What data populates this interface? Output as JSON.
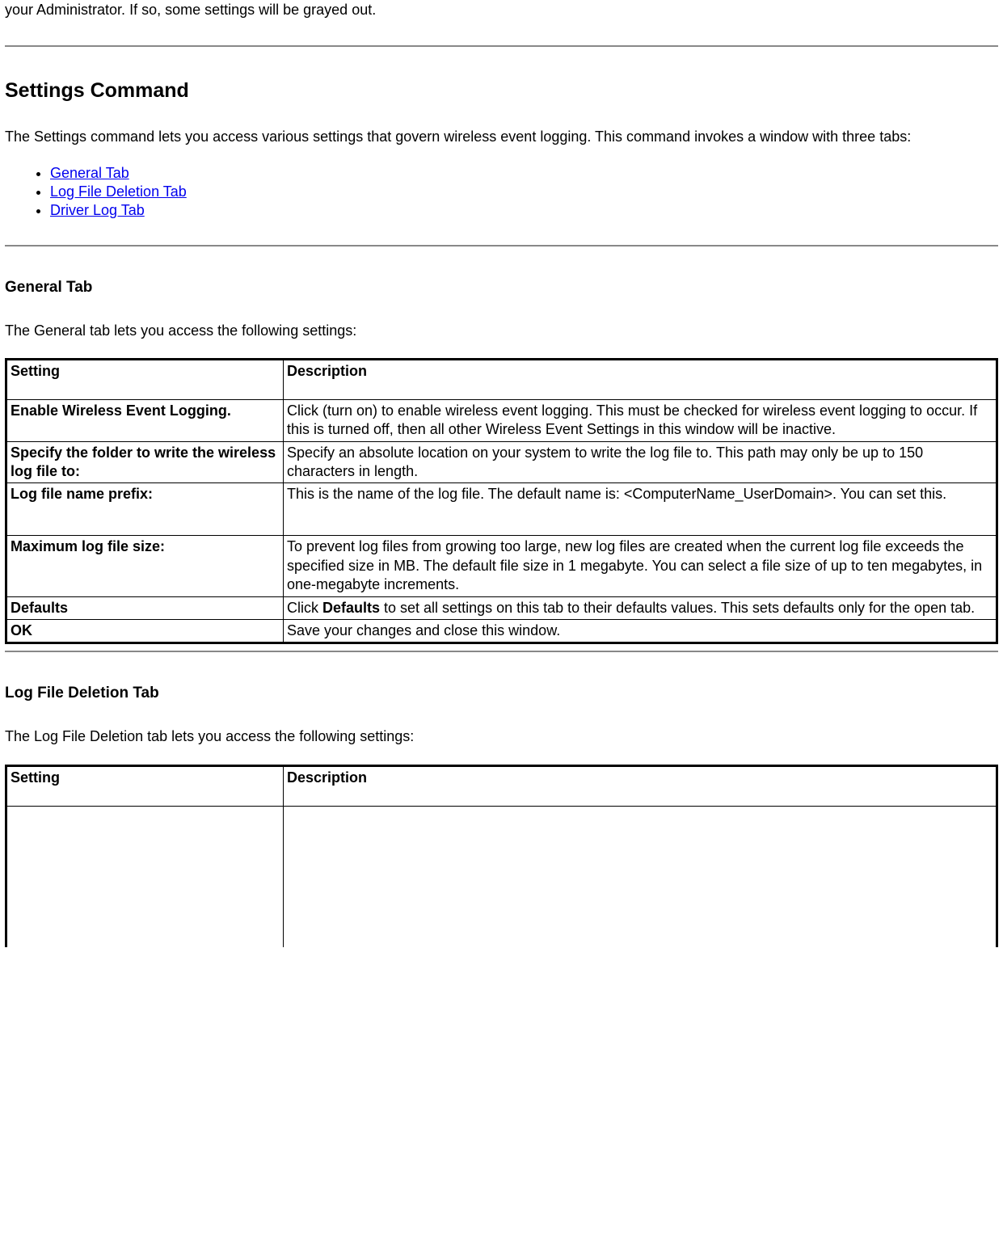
{
  "topFragment": "your Administrator. If so, some settings will be grayed out.",
  "settingsCommand": {
    "heading": "Settings Command",
    "intro": "The Settings command lets you access various settings that govern wireless event logging. This command invokes a window with three tabs:",
    "links": [
      "General Tab ",
      "Log File Deletion Tab",
      "Driver Log Tab"
    ]
  },
  "generalTab": {
    "heading": "General Tab",
    "intro": "The General tab lets you access the following settings:",
    "header": {
      "setting": "Setting",
      "description": "Description"
    },
    "rows": [
      {
        "setting": "Enable Wireless Event Logging.",
        "desc": "Click (turn on) to enable wireless event logging. This must be checked for wireless event logging to occur. If this is turned off, then all other Wireless Event Settings in this window will be inactive."
      },
      {
        "setting": "Specify the folder to write the wireless log file to:",
        "desc": "Specify an absolute location on your system to write the log file to. This path may only be up to 150 characters in length."
      },
      {
        "setting": "Log file name prefix:",
        "desc": "This is the name of the log file. The default name is: <ComputerName_UserDomain>. You can set this."
      },
      {
        "setting": "Maximum log file size:",
        "desc": "To prevent log files from growing too large, new log files are created when the current log file exceeds the specified size in MB. The default file size in 1 megabyte. You can select a file size of up to ten megabytes, in one-megabyte increments."
      },
      {
        "setting": "Defaults",
        "desc_pre": "Click ",
        "desc_bold": "Defaults",
        "desc_post": " to set all settings on this tab to their defaults values. This sets defaults only for the open tab."
      },
      {
        "setting": "OK",
        "desc": "Save your changes and close this window."
      }
    ]
  },
  "logFileDeletionTab": {
    "heading": "Log File Deletion Tab",
    "intro": "The Log File Deletion tab lets you access the following settings:",
    "header": {
      "setting": "Setting",
      "description": "Description"
    }
  }
}
